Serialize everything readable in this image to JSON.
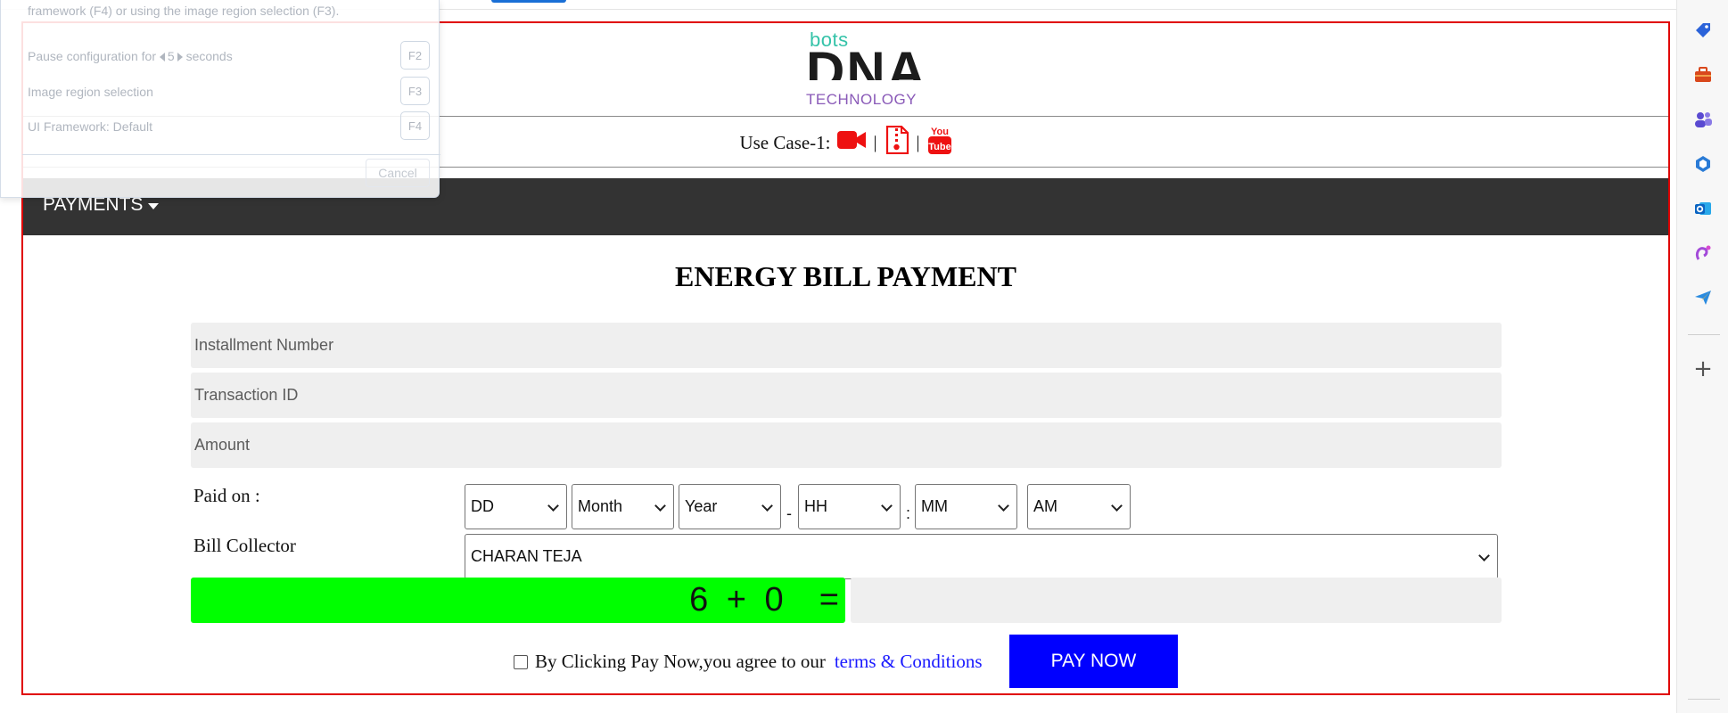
{
  "logo": {
    "small": "bots",
    "main": "DNA",
    "sub": "TECHNOLOGY"
  },
  "usecase": {
    "label": "Use Case-1:",
    "sep": "|"
  },
  "nav": {
    "payments": "PAYMENTS"
  },
  "title": "ENERGY BILL PAYMENT",
  "form": {
    "installment_placeholder": "Installment Number",
    "transaction_placeholder": "Transaction ID",
    "amount_placeholder": "Amount",
    "paid_on_label": "Paid on :",
    "dd": "DD",
    "month": "Month",
    "year": "Year",
    "dash": "-",
    "hh": "HH",
    "colon": ":",
    "mm": "MM",
    "ampm": "AM",
    "collector_label": "Bill Collector",
    "collector_value": "CHARAN TEJA",
    "captcha": "6 + 0  =",
    "agree_text": "By Clicking Pay Now,you agree to our",
    "terms": "terms & Conditions",
    "pay_now": "PAY NOW"
  },
  "panel": {
    "top_text": "framework (F4) or using the image region selection (F3).",
    "pause_prefix": "Pause configuration for",
    "pause_value": "5",
    "pause_suffix": "seconds",
    "f2": "F2",
    "image_region": "Image region selection",
    "f3": "F3",
    "ui_framework": "UI Framework:  Default",
    "f4": "F4",
    "cancel": "Cancel"
  },
  "colors": {
    "frame": "#e00000",
    "nav": "#333333",
    "captcha": "#00ff00",
    "pay": "#0000ff",
    "link": "#1a1aff"
  },
  "sidebar_icons": [
    "tag-icon",
    "briefcase-icon",
    "people-icon",
    "copilot-icon",
    "outlook-icon",
    "designer-icon",
    "send-icon",
    "add-icon"
  ]
}
